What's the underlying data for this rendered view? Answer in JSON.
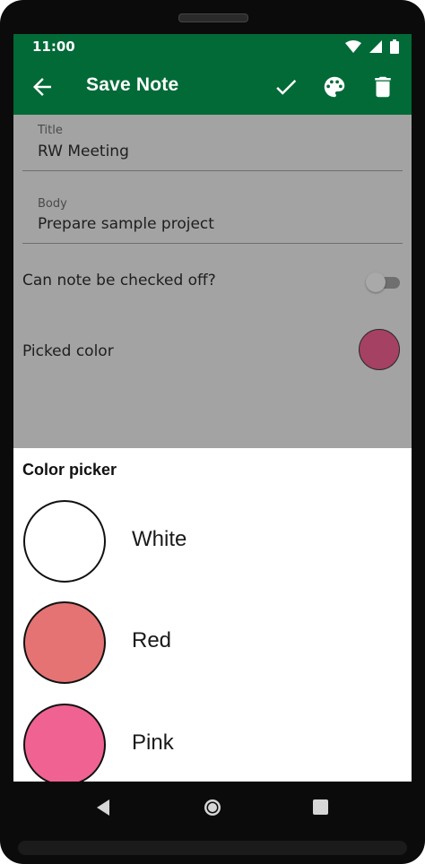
{
  "status_bar": {
    "time": "11:00",
    "icons": [
      "wifi-icon",
      "cellular-signal-icon",
      "battery-icon"
    ]
  },
  "app_bar": {
    "title": "Save Note",
    "background_color": "#026a37",
    "actions": [
      "back-arrow-icon",
      "check-icon",
      "palette-icon",
      "trash-icon"
    ]
  },
  "form": {
    "title_field": {
      "label": "Title",
      "value": "RW Meeting"
    },
    "body_field": {
      "label": "Body",
      "value": "Prepare sample project"
    },
    "checkable": {
      "label": "Can note be checked off?",
      "enabled": false
    },
    "picked_color": {
      "label": "Picked color",
      "color": "#a54163"
    }
  },
  "color_picker": {
    "title": "Color picker",
    "colors": [
      {
        "name": "White",
        "hex": "#ffffff"
      },
      {
        "name": "Red",
        "hex": "#e57373"
      },
      {
        "name": "Pink",
        "hex": "#f06292"
      }
    ]
  },
  "nav_bar": {
    "buttons": [
      "back-triangle-icon",
      "home-circle-icon",
      "recents-square-icon"
    ]
  }
}
